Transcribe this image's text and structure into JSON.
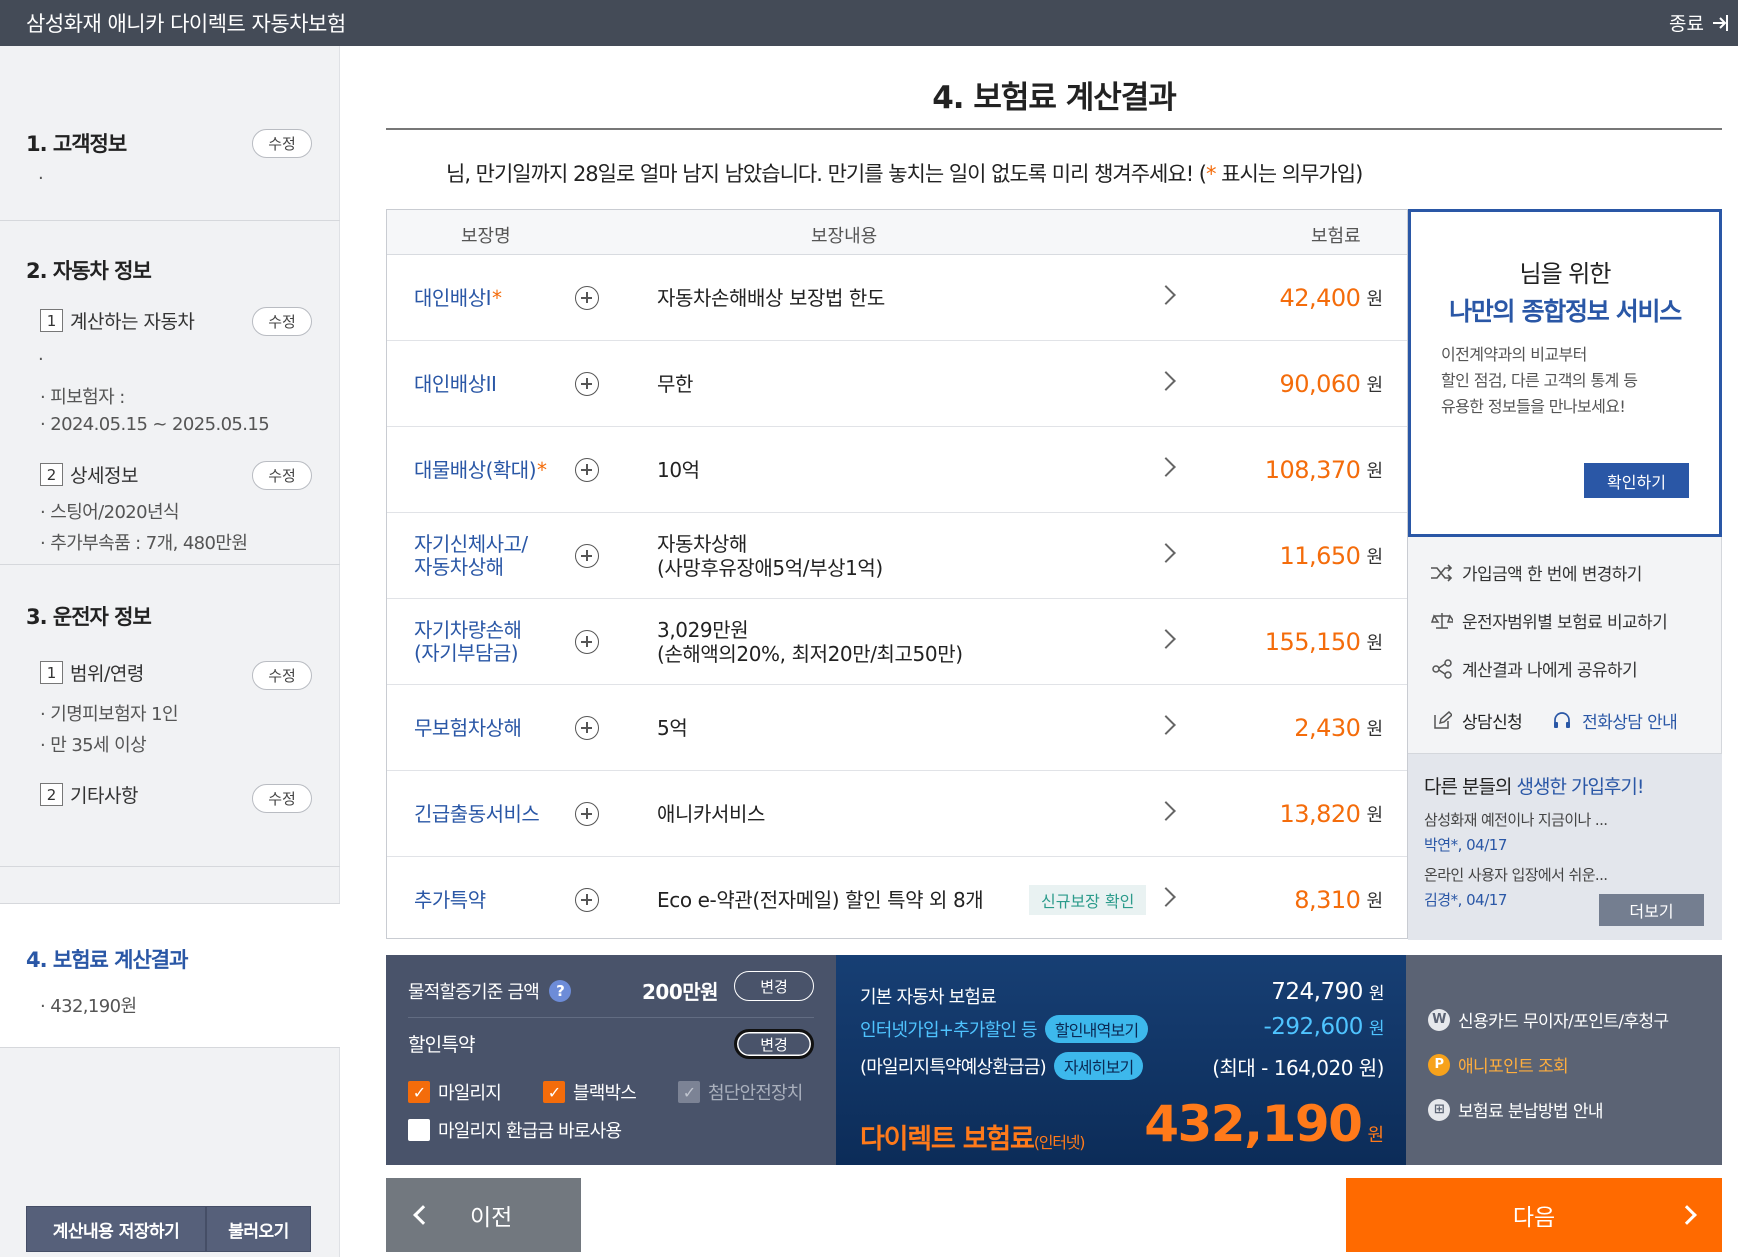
{
  "app": {
    "title": "삼성화재 애니카 다이렉트 자동차보험",
    "exit_label": "종료"
  },
  "sidebar": {
    "customer": {
      "title": "1. 고객정보",
      "edit": "수정",
      "detail": "·"
    },
    "car": {
      "title": "2. 자동차 정보",
      "calc_car": {
        "num": "1",
        "label": "계산하는 자동차",
        "edit": "수정",
        "dot": "·",
        "insured": "피보험자 :",
        "period": "2024.05.15 ~ 2025.05.15"
      },
      "detail": {
        "num": "2",
        "label": "상세정보",
        "edit": "수정",
        "model": "스팅어/2020년식",
        "parts": "추가부속품 : 7개, 480만원"
      }
    },
    "driver": {
      "title": "3. 운전자 정보",
      "range": {
        "num": "1",
        "label": "범위/연령",
        "edit": "수정",
        "scope": "기명피보험자 1인",
        "age": "만 35세 이상"
      },
      "other": {
        "num": "2",
        "label": "기타사항",
        "edit": "수정"
      }
    },
    "result": {
      "title": "4. 보험료 계산결과",
      "amount": "432,190원"
    },
    "save_label": "계산내용 저장하기",
    "load_label": "불러오기"
  },
  "main": {
    "title": "4. 보험료 계산결과",
    "notice": {
      "text": "님, 만기일까지 28일로 얼마 남지 남았습니다. 만기를 놓치는 일이 없도록 미리 챙겨주세요! (",
      "star": "*",
      "suffix": " 표시는 의무가입)"
    },
    "table": {
      "headers": [
        "보장명",
        "보장내용",
        "보험료"
      ],
      "won": "원",
      "new_tag": "신규보장 확인",
      "rows": [
        {
          "name": "대인배상I",
          "star": "*",
          "desc1": "자동차손해배상 보장법 한도",
          "desc2": "",
          "premium": "42,400"
        },
        {
          "name": "대인배상II",
          "star": "",
          "desc1": "무한",
          "desc2": "",
          "premium": "90,060"
        },
        {
          "name": "대물배상(확대)",
          "star": "*",
          "desc1": "10억",
          "desc2": "",
          "premium": "108,370"
        },
        {
          "name": "자기신체사고/",
          "name2": "자동차상해",
          "star": "",
          "desc1": "자동차상해",
          "desc2": "(사망후유장애5억/부상1억)",
          "premium": "11,650"
        },
        {
          "name": "자기차량손해",
          "name2": "(자기부담금)",
          "star": "",
          "desc1": "3,029만원",
          "desc2": "(손해액의20%, 최저20만/최고50만)",
          "premium": "155,150"
        },
        {
          "name": "무보험차상해",
          "star": "",
          "desc1": "5억",
          "desc2": "",
          "premium": "2,430"
        },
        {
          "name": "긴급출동서비스",
          "star": "",
          "desc1": "애니카서비스",
          "desc2": "",
          "premium": "13,820"
        },
        {
          "name": "추가특약",
          "star": "",
          "desc1": "Eco e-약관(전자메일) 할인 특약 외 8개",
          "desc2": "",
          "premium": "8,310"
        }
      ]
    }
  },
  "right_panel": {
    "promo": {
      "line1": "님을 위한",
      "line2": "나만의 종합정보 서비스",
      "desc1": "이전계약과의 비교부터",
      "desc2": "할인 점검, 다른 고객의 통계 등",
      "desc3": "유용한 정보들을 만나보세요!",
      "button": "확인하기"
    },
    "links": [
      "가입금액 한 번에 변경하기",
      "운전자범위별 보험료 비교하기",
      "계산결과 나에게 공유하기"
    ],
    "consult": "상담신청",
    "phone": "전화상담 안내",
    "reviews": {
      "title_pre": "다른 분들의 ",
      "title_hl": "생생한 가입후기!",
      "r1_text": "삼성화재 예전이나 지금이나 ...",
      "r1_by": "박연*, 04/17",
      "r2_text": "온라인 사용자 입장에서 쉬운...",
      "r2_by": "김경*, 04/17",
      "more": "더보기"
    }
  },
  "discount": {
    "material_label": "물적할증기준 금액",
    "help": "?",
    "material_value": "200만원",
    "change": "변경",
    "special_label": "할인특약",
    "check_mark": "✓",
    "options": [
      {
        "label": "마일리지",
        "state": "checked"
      },
      {
        "label": "블랙박스",
        "state": "checked"
      },
      {
        "label": "첨단안전장치",
        "state": "disabled"
      },
      {
        "label": "마일리지 환급금 바로사용",
        "state": "unchecked"
      }
    ]
  },
  "calc": {
    "base_label": "기본 자동차 보험료",
    "base_value": "724,790",
    "inet_label": "인터넷가입+추가할인 등",
    "inet_pill": "할인내역보기",
    "inet_value": "-292,600",
    "mileage_label": "(마일리지특약예상환급금)",
    "mileage_pill": "자세히보기",
    "mileage_value": "(최대 - 164,020 원)",
    "direct_label": "다이렉트 보험료",
    "direct_sub": "(인터넷)",
    "total": "432,190",
    "won": "원"
  },
  "payment": {
    "card": "신용카드 무이자/포인트/후청구",
    "card_icon": "W",
    "point": "애니포인트 조회",
    "point_icon": "P",
    "install": "보험료 분납방법 안내",
    "install_icon": "⊞"
  },
  "nav": {
    "prev": "이전",
    "next": "다음"
  },
  "colors": {
    "accent_orange": "#f46c0b",
    "primary_blue": "#2a57a6",
    "nav_dark": "#444b57",
    "calc_navy": "#0c2c58",
    "next_orange": "#ff6a00"
  }
}
